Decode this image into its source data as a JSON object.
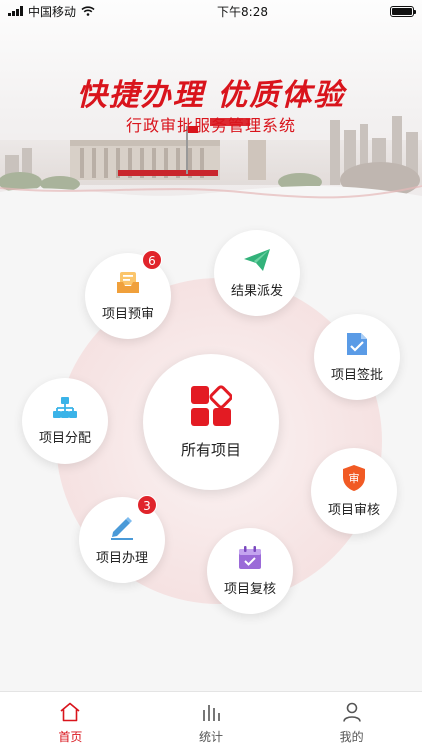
{
  "status_bar": {
    "carrier": "中国移动",
    "time": "下午8:28"
  },
  "banner": {
    "title": "快捷办理  优质体验",
    "subtitle": "行政审批服务管理系统"
  },
  "center": {
    "label": "所有项目",
    "icon": "grid-icon"
  },
  "nodes": [
    {
      "key": "preview",
      "label": "项目预审",
      "icon": "mail-tray-icon",
      "color": "#f0a03b",
      "badge": "6"
    },
    {
      "key": "dispatch",
      "label": "结果派发",
      "icon": "paper-plane-icon",
      "color": "#33b27a",
      "badge": ""
    },
    {
      "key": "sign",
      "label": "项目签批",
      "icon": "document-check-icon",
      "color": "#4a8fe0",
      "badge": ""
    },
    {
      "key": "assign",
      "label": "项目分配",
      "icon": "org-chart-icon",
      "color": "#3ab3e8",
      "badge": ""
    },
    {
      "key": "review",
      "label": "项目审核",
      "icon": "shield-icon",
      "color": "#f15a24",
      "badge": "",
      "glyph": "审"
    },
    {
      "key": "handle",
      "label": "项目办理",
      "icon": "pen-icon",
      "color": "#4a9ad8",
      "badge": "3"
    },
    {
      "key": "recheck",
      "label": "项目复核",
      "icon": "calendar-check-icon",
      "color": "#9b6ad8",
      "badge": ""
    }
  ],
  "tabs": [
    {
      "label": "首页",
      "icon": "home-icon",
      "active": true
    },
    {
      "label": "统计",
      "icon": "bar-chart-icon",
      "active": false
    },
    {
      "label": "我的",
      "icon": "user-icon",
      "active": false
    }
  ],
  "colors": {
    "brand": "#d9141c",
    "badge": "#e0242b"
  }
}
